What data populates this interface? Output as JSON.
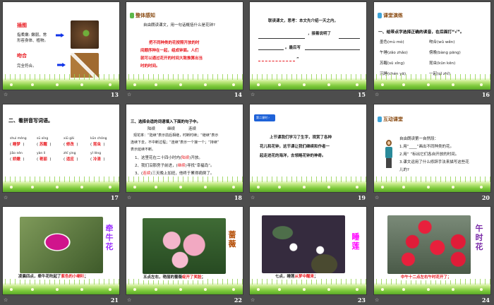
{
  "slides": [
    {
      "number": "13",
      "term1": "插图",
      "def1": "指柔嫩: 嫩弱，常",
      "def1b": "形容身体、植物。",
      "term2": "吻合",
      "def2": "完全符合。"
    },
    {
      "number": "14",
      "title": "整体感知",
      "question": "自由朗读课文，用一句话概括什么是花钟?",
      "answer": [
        "把不同种类的花按照开放的时",
        "间顺序种在一起，组成钟面。人们",
        "就可以通过花开的时间大致推算出当",
        "时的时间。"
      ]
    },
    {
      "number": "15",
      "line1": "联读课文，思考：本文先介绍一天之内，",
      "line2": "，接着说明了",
      "line3": "。最后写",
      "line4": "”"
    },
    {
      "number": "16",
      "title": "课堂演练",
      "instruction": "一、给带点字选择正确的读音，在后面打“√”。",
      "items": [
        "墨色(mù  mò)",
        "吻合(wǔ  wěn)",
        "午睡(zǎo  zhǎo)",
        "傍晚(bàng  pāng)",
        "苏醒(sū  xǐng)",
        "昆虫(kūn  kēn)",
        "沉睡(chén  yā)",
        "一起(qǐ  zhǐ)"
      ]
    },
    {
      "number": "17",
      "title": "二、看拼音写词语。",
      "pinyin": [
        "shuì mèng",
        "sū xǐng",
        "xiū gǎi",
        "kūn chóng",
        "jiāo nèn",
        "yàn lì",
        "zhī yìng",
        "yǐ lěng"
      ],
      "words": [
        "睡梦",
        "苏醒",
        "修改",
        "昆虫",
        "娇嫩",
        "艳丽",
        "适应",
        "冷清"
      ]
    },
    {
      "number": "18",
      "title": "三、选择合适的词语填入下面的句子中。",
      "options": [
        "陆续",
        "继续",
        "连续"
      ],
      "para": [
        "观花率：“陆续”表示前后相继，时断时续；“继续”表示",
        "连续下去，不中断过程；“连续”表示一个接一个；“持续”",
        "表示延续不断。"
      ],
      "s1": "1、这里花在二十四小时内(",
      "a1": "陆续",
      "s1b": ")开放。",
      "s2": "2、我们沿那房子前进，(",
      "a2": "继续",
      "s2b": ")寻找“幸福岛”。",
      "s3": "3、(",
      "a3": "连续",
      "s3b": ")三天晚上加班，他终于累得病倒了。"
    },
    {
      "number": "19",
      "badge": "第二课时",
      "text": [
        "上节课我们学习了生字，观赏了各种",
        "花儿和花钟，这节课让我们继续和作者一",
        "起走进花的海洋，去领略花钟的神奇。"
      ]
    },
    {
      "number": "20",
      "title": "互动课堂",
      "lines": [
        "自由朗读第一自然段：",
        "1.用“____”画出不同种类的花。",
        "2.用“  ”标出它们各自开放的时间。",
        "3.课文运用了什么修辞手法来描写这些花",
        "儿的?"
      ]
    },
    {
      "number": "21",
      "flower": "牵牛花",
      "caption": "凌晨四点，牵牛花吹起了",
      "highlight": "紫色的小喇叭",
      "end": "；"
    },
    {
      "number": "22",
      "flower": "蔷薇",
      "caption": "五点左右，艳丽的蔷薇",
      "highlight": "绽开了笑脸",
      "end": "；"
    },
    {
      "number": "23",
      "flower": "睡莲",
      "caption": "七点，睡莲",
      "highlight": "从梦中醒来",
      "end": "；"
    },
    {
      "number": "24",
      "flower": "午时花",
      "caption": "中午十二点左右午时花开了；"
    }
  ],
  "colors": {
    "background": "#4d4d4d",
    "accent_red": "#e8181e",
    "flower_purple": "#9b30ff",
    "flower_brown": "#b34a00",
    "flower_magenta": "#ff00ff",
    "flower_violet": "#7a2ba8"
  }
}
